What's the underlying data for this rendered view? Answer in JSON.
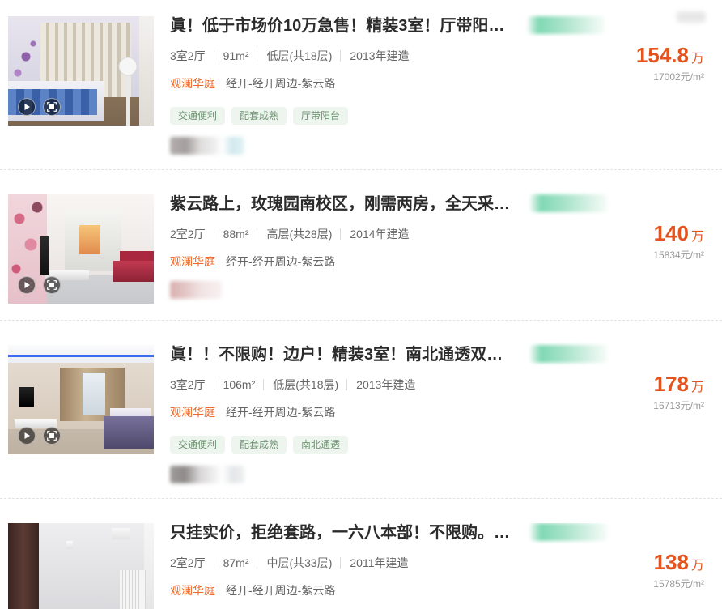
{
  "listings": [
    {
      "title": "眞！低于市场价10万急售！精装3室！厅带阳…",
      "layout": "3室2厅",
      "area": "91m²",
      "floor": "低层(共18层)",
      "built": "2013年建造",
      "community": "观澜华庭",
      "location": "经开-经开周边-紫云路",
      "tags": [
        "交通便利",
        "配套成熟",
        "厅带阳台"
      ],
      "price": "154.8",
      "price_unit": "万",
      "unit_price": "17002元/m²",
      "media_icons": [
        "play-icon",
        "gallery-icon"
      ]
    },
    {
      "title": "紫云路上，玫瑰园南校区，刚需两房，全天采…",
      "layout": "2室2厅",
      "area": "88m²",
      "floor": "高层(共28层)",
      "built": "2014年建造",
      "community": "观澜华庭",
      "location": "经开-经开周边-紫云路",
      "tags": [],
      "price": "140",
      "price_unit": "万",
      "unit_price": "15834元/m²",
      "media_icons": [
        "play-icon",
        "gallery-icon"
      ]
    },
    {
      "title": "眞！！不限购！边户！精装3室！南北通透双…",
      "layout": "3室2厅",
      "area": "106m²",
      "floor": "低层(共18层)",
      "built": "2013年建造",
      "community": "观澜华庭",
      "location": "经开-经开周边-紫云路",
      "tags": [
        "交通便利",
        "配套成熟",
        "南北通透"
      ],
      "price": "178",
      "price_unit": "万",
      "unit_price": "16713元/m²",
      "media_icons": [
        "play-icon",
        "gallery-icon"
      ]
    },
    {
      "title": "只挂实价，拒绝套路，一六八本部！不限购。…",
      "layout": "2室2厅",
      "area": "87m²",
      "floor": "中层(共33层)",
      "built": "2011年建造",
      "community": "观澜华庭",
      "location": "经开-经开周边-紫云路",
      "tags": [],
      "price": "138",
      "price_unit": "万",
      "unit_price": "15785元/m²",
      "media_icons": []
    }
  ],
  "colors": {
    "price": "#e3541f",
    "community": "#ec6a2c",
    "tag_text": "#6c9370",
    "tag_bg": "#eef5ef"
  }
}
